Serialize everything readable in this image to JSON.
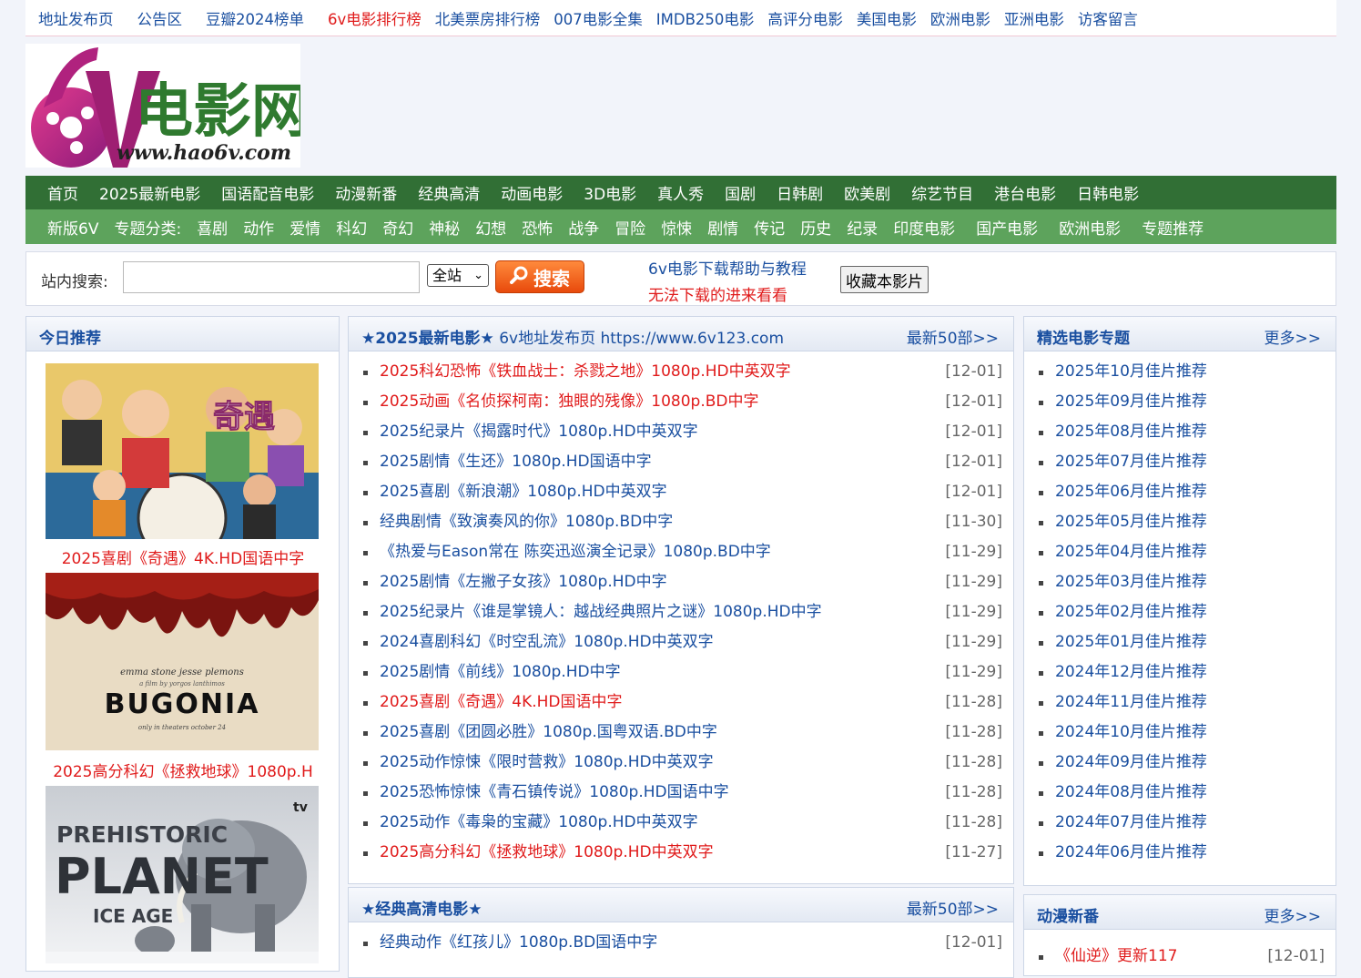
{
  "top_links": [
    {
      "label": "地址发布页",
      "red": false
    },
    {
      "label": "公告区",
      "red": false
    },
    {
      "label": "豆瓣2024榜单",
      "red": false
    },
    {
      "label": "6v电影排行榜",
      "red": true
    },
    {
      "label": "北美票房排行榜",
      "red": false
    },
    {
      "label": "007电影全集",
      "red": false
    },
    {
      "label": "IMDB250电影",
      "red": false
    },
    {
      "label": "高评分电影",
      "red": false
    },
    {
      "label": "美国电影",
      "red": false
    },
    {
      "label": "欧洲电影",
      "red": false
    },
    {
      "label": "亚洲电影",
      "red": false
    },
    {
      "label": "访客留言",
      "red": false
    }
  ],
  "logo": {
    "mark": "6V",
    "name": "电影网",
    "url": "www.hao6v.com"
  },
  "nav_main": [
    "首页",
    "2025最新电影",
    "国语配音电影",
    "动漫新番",
    "经典高清",
    "动画电影",
    "3D电影",
    "真人秀",
    "国剧",
    "日韩剧",
    "欧美剧",
    "综艺节目",
    "港台电影",
    "日韩电影"
  ],
  "nav_sub": [
    "新版6V",
    "专题分类:",
    "喜剧",
    "动作",
    "爱情",
    "科幻",
    "奇幻",
    "神秘",
    "幻想",
    "恐怖",
    "战争",
    "冒险",
    "惊悚",
    "剧情",
    "传记",
    "历史",
    "纪录",
    "印度电影",
    "国产电影",
    "欧洲电影",
    "专题推荐"
  ],
  "search": {
    "label": "站内搜索:",
    "value": "",
    "scope": "全站",
    "button": "搜索",
    "help_link": "6v电影下载帮助与教程",
    "download_help": "无法下载的进来看看",
    "favorite": "收藏本影片"
  },
  "today": {
    "title": "今日推荐",
    "items": [
      {
        "caption": "2025喜剧《奇遇》4K.HD国语中字"
      },
      {
        "caption": "2025高分科幻《拯救地球》1080p.H"
      },
      {
        "caption": ""
      }
    ]
  },
  "poster2": {
    "line1": "emma stone  jesse plemons",
    "line2": "a film by yorgos lanthimos",
    "title": "BUGONIA",
    "line3": "only in theaters october 24"
  },
  "poster3": {
    "line1": "PREHISTORIC",
    "line2": "PLANET",
    "line3": "ICE AGE",
    "badge": "tv"
  },
  "poster1": {
    "title": "奇遇"
  },
  "latest": {
    "title": "★2025最新电影★",
    "subtitle": " 6v地址发布页 https://www.6v123.com",
    "more": "最新50部>>",
    "items": [
      {
        "title": "2025科幻恐怖《铁血战士：杀戮之地》1080p.HD中英双字",
        "date": "[12-01]",
        "red": true
      },
      {
        "title": "2025动画《名侦探柯南：独眼的残像》1080p.BD中字",
        "date": "[12-01]",
        "red": true
      },
      {
        "title": "2025纪录片《揭露时代》1080p.HD中英双字",
        "date": "[12-01]",
        "red": false
      },
      {
        "title": "2025剧情《生还》1080p.HD国语中字",
        "date": "[12-01]",
        "red": false
      },
      {
        "title": "2025喜剧《新浪潮》1080p.HD中英双字",
        "date": "[12-01]",
        "red": false
      },
      {
        "title": "经典剧情《致演奏风的你》1080p.BD中字",
        "date": "[11-30]",
        "red": false
      },
      {
        "title": "《热爱与Eason常在 陈奕迅巡演全记录》1080p.BD中字",
        "date": "[11-29]",
        "red": false
      },
      {
        "title": "2025剧情《左撇子女孩》1080p.HD中字",
        "date": "[11-29]",
        "red": false
      },
      {
        "title": "2025纪录片《谁是掌镜人：越战经典照片之谜》1080p.HD中字",
        "date": "[11-29]",
        "red": false
      },
      {
        "title": "2024喜剧科幻《时空乱流》1080p.HD中英双字",
        "date": "[11-29]",
        "red": false
      },
      {
        "title": "2025剧情《前线》1080p.HD中字",
        "date": "[11-29]",
        "red": false
      },
      {
        "title": "2025喜剧《奇遇》4K.HD国语中字",
        "date": "[11-28]",
        "red": true
      },
      {
        "title": "2025喜剧《团圆必胜》1080p.国粤双语.BD中字",
        "date": "[11-28]",
        "red": false
      },
      {
        "title": "2025动作惊悚《限时营救》1080p.HD中英双字",
        "date": "[11-28]",
        "red": false
      },
      {
        "title": "2025恐怖惊悚《青石镇传说》1080p.HD国语中字",
        "date": "[11-28]",
        "red": false
      },
      {
        "title": "2025动作《毒枭的宝藏》1080p.HD中英双字",
        "date": "[11-28]",
        "red": false
      },
      {
        "title": "2025高分科幻《拯救地球》1080p.HD中英双字",
        "date": "[11-27]",
        "red": true
      }
    ]
  },
  "classic": {
    "title": "★经典高清电影★",
    "more": "最新50部>>",
    "items": [
      {
        "title": "经典动作《红孩儿》1080p.BD国语中字",
        "date": "[12-01]",
        "red": false
      }
    ]
  },
  "topics": {
    "title": "精选电影专题",
    "more": "更多>>",
    "items": [
      "2025年10月佳片推荐",
      "2025年09月佳片推荐",
      "2025年08月佳片推荐",
      "2025年07月佳片推荐",
      "2025年06月佳片推荐",
      "2025年05月佳片推荐",
      "2025年04月佳片推荐",
      "2025年03月佳片推荐",
      "2025年02月佳片推荐",
      "2025年01月佳片推荐",
      "2024年12月佳片推荐",
      "2024年11月佳片推荐",
      "2024年10月佳片推荐",
      "2024年09月佳片推荐",
      "2024年08月佳片推荐",
      "2024年07月佳片推荐",
      "2024年06月佳片推荐"
    ]
  },
  "anime": {
    "title": "动漫新番",
    "more": "更多>>",
    "items": [
      {
        "title": "《仙逆》更新117",
        "date": "[12-01]",
        "red": true
      }
    ]
  },
  "colors": {
    "nav_main": "#316f35",
    "nav_sub": "#5da35c",
    "link": "#1a4fa0",
    "highlight": "#e01b1b"
  }
}
